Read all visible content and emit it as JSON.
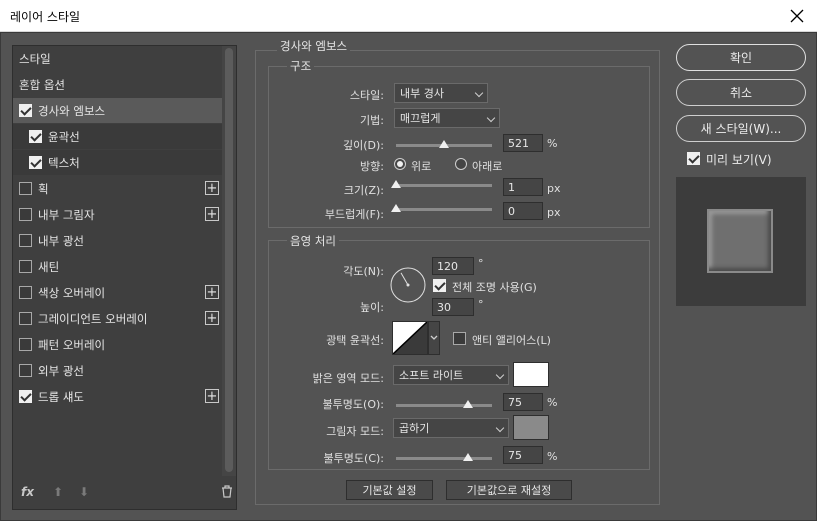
{
  "window": {
    "title": "레이어 스타일"
  },
  "styles_list": {
    "items": [
      {
        "label": "스타일",
        "checkbox": false,
        "checked": false,
        "plus": false,
        "state": "normal"
      },
      {
        "label": "혼합 옵션",
        "checkbox": false,
        "checked": false,
        "plus": false,
        "state": "normal"
      },
      {
        "label": "경사와 엠보스",
        "checkbox": true,
        "checked": true,
        "plus": false,
        "state": "selected"
      },
      {
        "label": "윤곽선",
        "checkbox": true,
        "checked": true,
        "plus": false,
        "state": "sub"
      },
      {
        "label": "텍스처",
        "checkbox": true,
        "checked": true,
        "plus": false,
        "state": "sub"
      },
      {
        "label": "획",
        "checkbox": true,
        "checked": false,
        "plus": true,
        "state": "normal"
      },
      {
        "label": "내부 그림자",
        "checkbox": true,
        "checked": false,
        "plus": true,
        "state": "normal"
      },
      {
        "label": "내부 광선",
        "checkbox": true,
        "checked": false,
        "plus": false,
        "state": "normal"
      },
      {
        "label": "새틴",
        "checkbox": true,
        "checked": false,
        "plus": false,
        "state": "normal"
      },
      {
        "label": "색상 오버레이",
        "checkbox": true,
        "checked": false,
        "plus": true,
        "state": "normal"
      },
      {
        "label": "그레이디언트 오버레이",
        "checkbox": true,
        "checked": false,
        "plus": true,
        "state": "normal"
      },
      {
        "label": "패턴 오버레이",
        "checkbox": true,
        "checked": false,
        "plus": false,
        "state": "normal"
      },
      {
        "label": "외부 광선",
        "checkbox": true,
        "checked": false,
        "plus": false,
        "state": "normal"
      },
      {
        "label": "드롭 섀도",
        "checkbox": true,
        "checked": true,
        "plus": true,
        "state": "normal"
      }
    ],
    "footer": {
      "fx": "fx",
      "up": "⬆",
      "down": "⬇",
      "trash": "🗑"
    }
  },
  "bevel_emboss": {
    "title": "경사와 엠보스",
    "structure": {
      "title": "구조",
      "style_label": "스타일:",
      "style_value": "내부 경사",
      "technique_label": "기법:",
      "technique_value": "매끄럽게",
      "depth_label": "깊이(D):",
      "depth_value": "521",
      "depth_unit": "%",
      "depth_fraction": 0.5,
      "direction_label": "방향:",
      "direction_up": "위로",
      "direction_down": "아래로",
      "direction_selected": "up",
      "size_label": "크기(Z):",
      "size_value": "1",
      "size_unit": "px",
      "size_fraction": 0.0,
      "soften_label": "부드럽게(F):",
      "soften_value": "0",
      "soften_unit": "px",
      "soften_fraction": 0.0
    },
    "shading": {
      "title": "음영 처리",
      "angle_label": "각도(N):",
      "angle_value": "120",
      "angle_unit": "°",
      "angle_degrees": 120,
      "global_light_label": "전체 조명 사용(G)",
      "global_light_checked": true,
      "altitude_label": "높이:",
      "altitude_value": "30",
      "altitude_unit": "°",
      "gloss_contour_label": "광택 윤곽선:",
      "anti_alias_label": "앤티 앨리어스(L)",
      "anti_alias_checked": false,
      "highlight_mode_label": "밝은 영역 모드:",
      "highlight_mode_value": "소프트 라이트",
      "highlight_color": "#ffffff",
      "highlight_opacity_label": "불투명도(O):",
      "highlight_opacity_value": "75",
      "highlight_opacity_unit": "%",
      "highlight_opacity_fraction": 0.75,
      "shadow_mode_label": "그림자 모드:",
      "shadow_mode_value": "곱하기",
      "shadow_color": "#8a8a8a",
      "shadow_opacity_label": "불투명도(C):",
      "shadow_opacity_value": "75",
      "shadow_opacity_unit": "%",
      "shadow_opacity_fraction": 0.75
    },
    "make_default": "기본값 설정",
    "reset_default": "기본값으로 재설정"
  },
  "actions": {
    "ok": "확인",
    "cancel": "취소",
    "new_style": "새 스타일(W)...",
    "preview_label": "미리 보기(V)",
    "preview_checked": true
  }
}
